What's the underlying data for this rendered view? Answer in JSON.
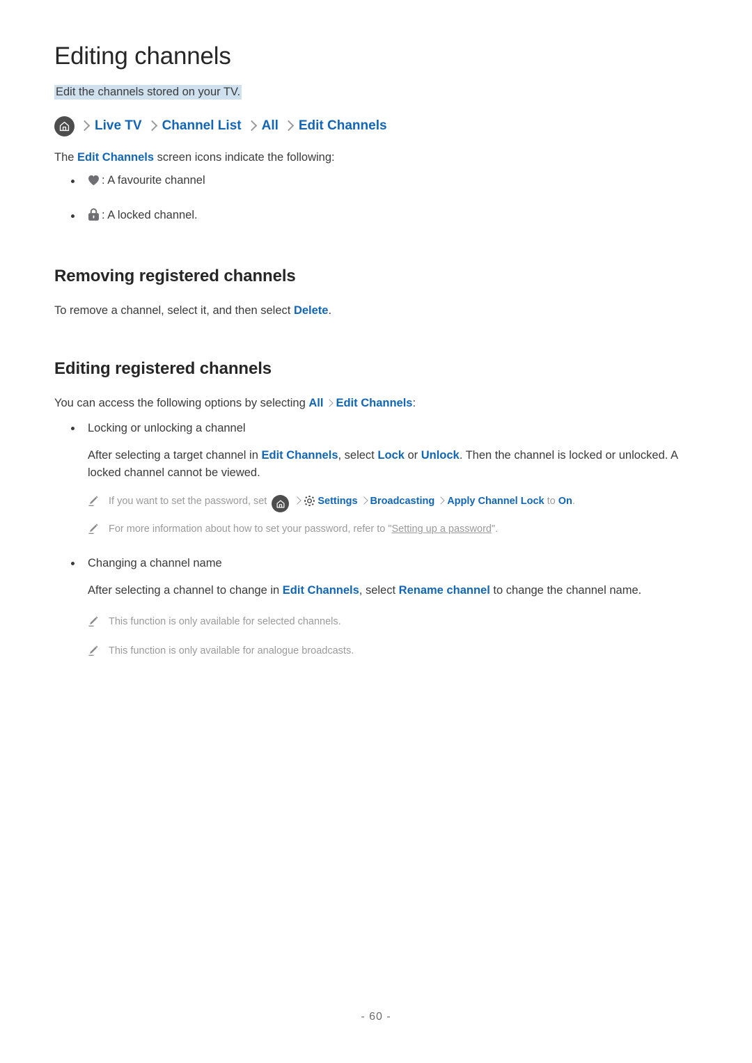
{
  "document": {
    "title": "Editing channels",
    "intro": "Edit the channels stored on your TV.",
    "page_number": "- 60 -",
    "accent_color": "#1266b5",
    "highlight_color": "#cfe0ef",
    "note_color": "#9a9a9a",
    "text_color": "#3a3a3a"
  },
  "breadcrumb": {
    "home_icon": "home-icon",
    "separator": "chevron-right-icon",
    "items": [
      "Live TV",
      "Channel List",
      "All",
      "Edit Channels"
    ]
  },
  "icon_legend": {
    "lead_in": {
      "pre": "The ",
      "link": "Edit Channels",
      "post": " screen icons indicate the following:"
    },
    "items": [
      {
        "icon": "heart-icon",
        "label": ": A favourite channel"
      },
      {
        "icon": "lock-icon",
        "label": ": A locked channel."
      }
    ]
  },
  "sections": [
    {
      "heading": "Removing registered channels",
      "body": {
        "pre": "To remove a channel, select it, and then select ",
        "link": "Delete",
        "post": "."
      }
    },
    {
      "heading": "Editing registered channels",
      "lead_in": {
        "pre": "You can access the following options by selecting ",
        "link1": "All",
        "separator": "chevron-right-icon",
        "link2": "Edit Channels",
        "post": ":"
      },
      "options": [
        {
          "title": "Locking or unlocking a channel",
          "body": {
            "p1": "After selecting a target channel in ",
            "link1": "Edit Channels",
            "p2": ", select ",
            "link2": "Lock",
            "p3": " or ",
            "link3": "Unlock",
            "p4": ". Then the channel is locked or unlocked. A locked channel cannot be viewed."
          },
          "notes": [
            {
              "icon": "pencil-icon",
              "pre": "If you want to set the password, set ",
              "home_icon": "home-icon",
              "gear_icon": "gear-icon",
              "crumb1": "Settings",
              "crumb2": "Broadcasting",
              "crumb3": "Apply Channel Lock",
              "mid": " to ",
              "crumb4": "On",
              "post": "."
            },
            {
              "icon": "pencil-icon",
              "pre": "For more information about how to set your password, refer to \"",
              "link": "Setting up a password",
              "post": "\"."
            }
          ]
        },
        {
          "title": "Changing a channel name",
          "body": {
            "p1": "After selecting a channel to change in ",
            "link1": "Edit Channels",
            "p2": ", select ",
            "link2": "Rename channel",
            "p3": " to change the channel name."
          },
          "notes": [
            {
              "icon": "pencil-icon",
              "text": "This function is only available for selected channels."
            },
            {
              "icon": "pencil-icon",
              "text": "This function is only available for analogue broadcasts."
            }
          ]
        }
      ]
    }
  ]
}
